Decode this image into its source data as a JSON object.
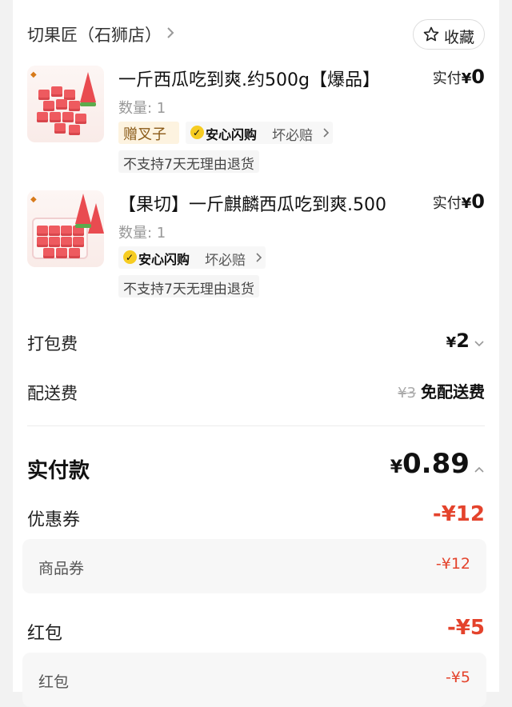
{
  "store": {
    "name": "切果匠（石狮店）",
    "favorite_label": "收藏"
  },
  "items": [
    {
      "title": "一斤西瓜吃到爽.约500g【爆品】",
      "pay_label": "实付",
      "pay_currency": "¥",
      "pay_amount": "0",
      "quantity": "数量: 1",
      "gift_tag": "赠叉子",
      "safe_tag": "安心闪购",
      "bad_tag": "坏必赔",
      "note": "不支持7天无理由退货"
    },
    {
      "title": "【果切】一斤麒麟西瓜吃到爽.500",
      "pay_label": "实付",
      "pay_currency": "¥",
      "pay_amount": "0",
      "quantity": "数量: 1",
      "safe_tag": "安心闪购",
      "bad_tag": "坏必赔",
      "note": "不支持7天无理由退货"
    }
  ],
  "fees": {
    "packing": {
      "label": "打包费",
      "currency": "¥",
      "amount": "2"
    },
    "delivery": {
      "label": "配送费",
      "original": "¥3",
      "value": "免配送费"
    }
  },
  "total": {
    "label": "实付款",
    "currency": "¥",
    "amount": "0.89"
  },
  "discounts": {
    "coupon": {
      "label": "优惠券",
      "amount": "-¥12",
      "sub_label": "商品券",
      "sub_amount": "-¥12"
    },
    "red_packet": {
      "label": "红包",
      "amount": "-¥5",
      "sub_label": "红包",
      "sub_amount": "-¥5"
    }
  },
  "colors": {
    "discount_red": "#e4432c",
    "badge_yellow": "#f6cc22",
    "gift_bg": "#fdf3e0"
  },
  "icons": {
    "favorite": "star-outline-icon",
    "store_chevron": "chevron-right-icon",
    "fee_chevron": "chevron-down-icon",
    "total_chevron": "chevron-up-icon"
  }
}
